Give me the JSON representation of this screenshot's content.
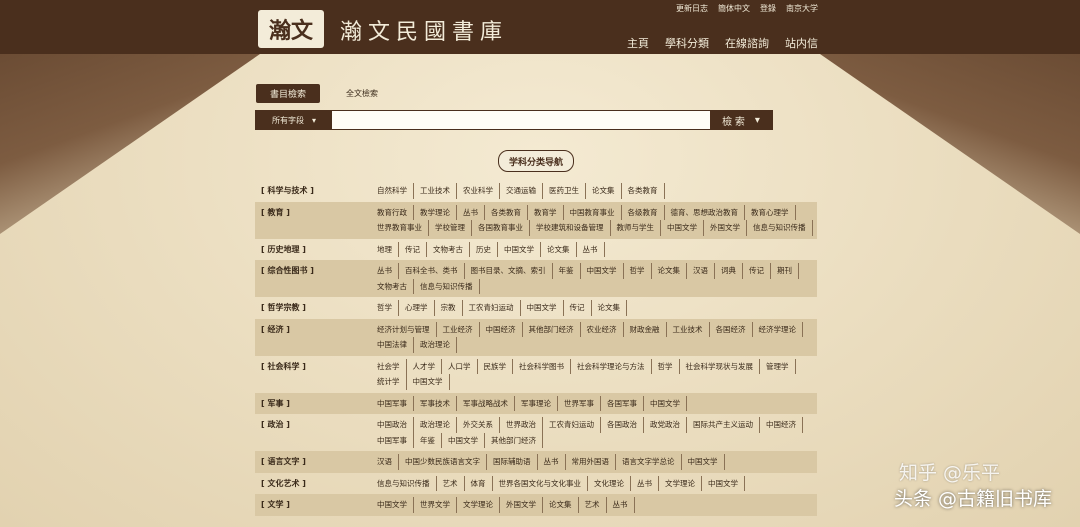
{
  "header": {
    "logo_text": "瀚文",
    "site_title": "瀚文民國書庫",
    "top_links": [
      "更新日志",
      "簡体中文",
      "登錄",
      "南京大学"
    ],
    "nav": [
      "主頁",
      "學科分類",
      "在線諮詢",
      "站内信"
    ]
  },
  "search": {
    "tabs": [
      "書目檢索",
      "全文檢索"
    ],
    "field_label": "所有字段",
    "input_placeholder": "",
    "button_label": "檢 索"
  },
  "section_title": "学科分类导航",
  "categories": [
    {
      "name": "[ 科学与技术 ]",
      "items": [
        "自然科学",
        "工业技术",
        "农业科学",
        "交通运输",
        "医药卫生",
        "论文集",
        "各类教育"
      ]
    },
    {
      "name": "[ 教育 ]",
      "items": [
        "教育行政",
        "教学理论",
        "丛书",
        "各类教育",
        "教育学",
        "中国教育事业",
        "各级教育",
        "德育、思想政治教育",
        "教育心理学",
        "世界教育事业",
        "学校管理",
        "各国教育事业",
        "学校建筑和设备管理",
        "教师与学生",
        "中国文学",
        "外国文学",
        "信息与知识传播"
      ]
    },
    {
      "name": "[ 历史地理 ]",
      "items": [
        "地理",
        "传记",
        "文物考古",
        "历史",
        "中国文学",
        "论文集",
        "丛书"
      ]
    },
    {
      "name": "[ 综合性图书 ]",
      "items": [
        "丛书",
        "百科全书、类书",
        "图书目录、文摘、索引",
        "年鉴",
        "中国文学",
        "哲学",
        "论文集",
        "汉语",
        "词典",
        "传记",
        "期刊",
        "文物考古",
        "信息与知识传播"
      ]
    },
    {
      "name": "[ 哲学宗教 ]",
      "items": [
        "哲学",
        "心理学",
        "宗教",
        "工农青妇运动",
        "中国文学",
        "传记",
        "论文集"
      ]
    },
    {
      "name": "[ 经济 ]",
      "items": [
        "经济计划与管理",
        "工业经济",
        "中国经济",
        "其他部门经济",
        "农业经济",
        "财政金融",
        "工业技术",
        "各国经济",
        "经济学理论",
        "中国法律",
        "政治理论"
      ]
    },
    {
      "name": "[ 社会科学 ]",
      "items": [
        "社会学",
        "人才学",
        "人口学",
        "民族学",
        "社会科学图书",
        "社会科学理论与方法",
        "哲学",
        "社会科学现状与发展",
        "管理学",
        "统计学",
        "中国文学"
      ]
    },
    {
      "name": "[ 军事 ]",
      "items": [
        "中国军事",
        "军事技术",
        "军事战略战术",
        "军事理论",
        "世界军事",
        "各国军事",
        "中国文学"
      ]
    },
    {
      "name": "[ 政治 ]",
      "items": [
        "中国政治",
        "政治理论",
        "外交关系",
        "世界政治",
        "工农青妇运动",
        "各国政治",
        "政党政治",
        "国际共产主义运动",
        "中国经济",
        "中国军事",
        "年鉴",
        "中国文学",
        "其他部门经济"
      ]
    },
    {
      "name": "[ 语言文字 ]",
      "items": [
        "汉语",
        "中国少数民族语言文字",
        "国际辅助语",
        "丛书",
        "常用外国语",
        "语言文字学总论",
        "中国文学"
      ]
    },
    {
      "name": "[ 文化艺术 ]",
      "items": [
        "信息与知识传播",
        "艺术",
        "体育",
        "世界各国文化与文化事业",
        "文化理论",
        "丛书",
        "文学理论",
        "中国文学"
      ]
    },
    {
      "name": "[ 文学 ]",
      "items": [
        "中国文学",
        "世界文学",
        "文学理论",
        "外国文学",
        "论文集",
        "艺术",
        "丛书"
      ]
    }
  ],
  "watermark": {
    "line1": "知乎 @乐平",
    "line2": "头条 @古籍旧书库"
  }
}
